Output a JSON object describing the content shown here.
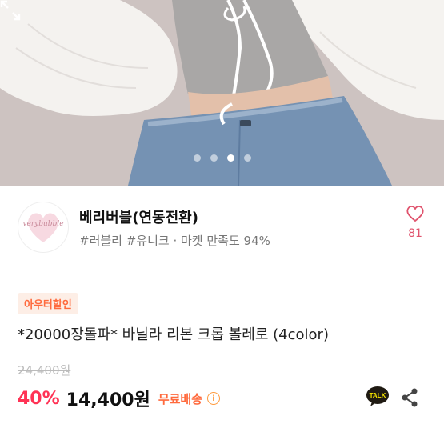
{
  "hero": {
    "slide_count": 4,
    "active_slide": 3
  },
  "store": {
    "logo_text": "verybubble",
    "name": "베리버블(연동전환)",
    "tags": "#러블리 #유니크 · 마켓 만족도 94%",
    "favorite_count": "81"
  },
  "product": {
    "badge": "아우터할인",
    "title": "*20000장돌파* 바닐라 리본 크롭 볼레로 (4color)",
    "original_price": "24,400원",
    "discount": "40%",
    "price": "14,400원",
    "shipping": "무료배송",
    "talk_label": "TALK"
  },
  "colors": {
    "discount": "#ff3355",
    "shipping": "#ff6a3d",
    "heart": "#e0546e"
  }
}
